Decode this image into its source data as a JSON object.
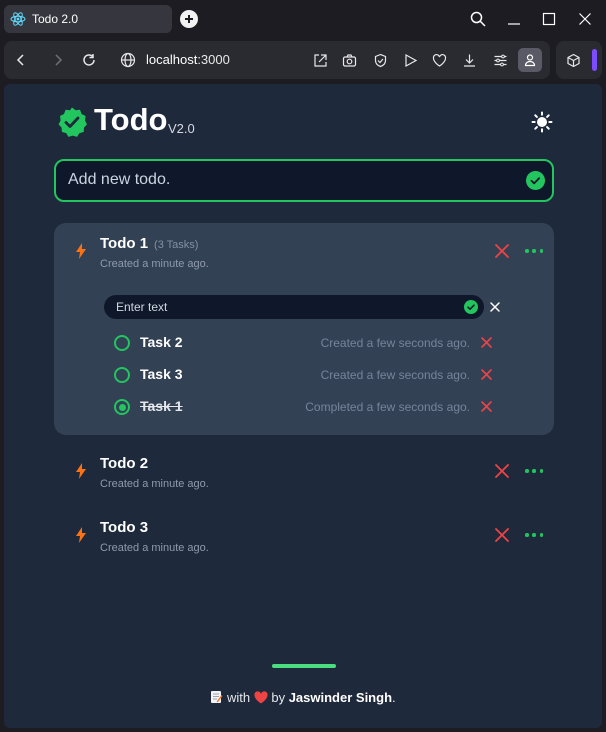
{
  "browser": {
    "tab_title": "Todo 2.0",
    "url_host": "localhost",
    "url_port": ":3000"
  },
  "app": {
    "title": "Todo",
    "version": "V2.0",
    "add_placeholder": "Add new todo.",
    "accent_color": "#22c55e",
    "danger_color": "#ef4444",
    "bolt_color": "#f97316"
  },
  "todos": [
    {
      "title": "Todo 1",
      "task_count": "(3 Tasks)",
      "created": "Created a minute ago.",
      "task_input_placeholder": "Enter text",
      "tasks": [
        {
          "name": "Task 2",
          "time": "Created a few seconds ago.",
          "completed": false
        },
        {
          "name": "Task 3",
          "time": "Created a few seconds ago.",
          "completed": false
        },
        {
          "name": "Task 1",
          "time": "Completed a few seconds ago.",
          "completed": true
        }
      ]
    },
    {
      "title": "Todo 2",
      "created": "Created a minute ago."
    },
    {
      "title": "Todo 3",
      "created": "Created a minute ago."
    }
  ],
  "footer": {
    "with_text": "with",
    "by_text": "by",
    "author": "Jaswinder Singh",
    "period": "."
  }
}
